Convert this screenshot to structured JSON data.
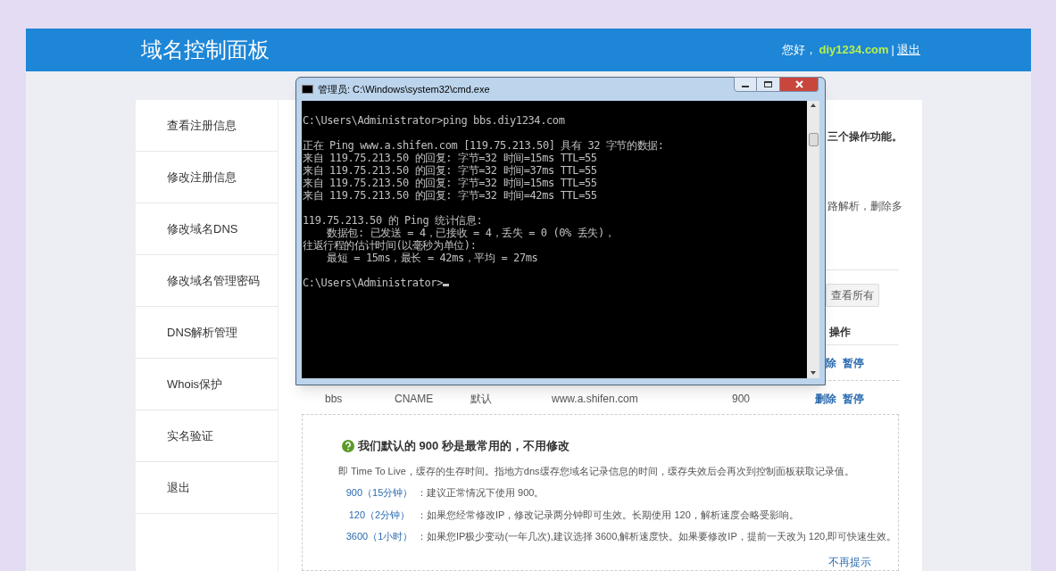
{
  "header": {
    "title": "域名控制面板",
    "greeting": "您好，",
    "account": "diy1234.com",
    "separator": "|",
    "logout": "退出"
  },
  "sidebar": {
    "items": [
      {
        "label": "查看注册信息"
      },
      {
        "label": "修改注册信息"
      },
      {
        "label": "修改域名DNS"
      },
      {
        "label": "修改域名管理密码"
      },
      {
        "label": "DNS解析管理"
      },
      {
        "label": "Whois保护"
      },
      {
        "label": "实名验证"
      },
      {
        "label": "退出"
      }
    ]
  },
  "content": {
    "notes": [
      "三个操作功能。",
      "路解析，删除多"
    ],
    "view_all_button": "查看所有",
    "column_header": "操作",
    "rows": [
      {
        "actions": [
          "除",
          "暂停"
        ]
      },
      {
        "cells": [
          "bbs",
          "CNAME",
          "默认",
          "www.a.shifen.com",
          "900"
        ],
        "actions": [
          "删除",
          "暂停"
        ]
      }
    ]
  },
  "tip": {
    "title": "我们默认的 900 秒是最常用的，不用修改",
    "description": "即 Time To Live，缓存的生存时间。指地方dns缓存您域名记录信息的时间，缓存失效后会再次到控制面板获取记录值。",
    "options": [
      {
        "label": "900（15分钟）",
        "text": "：建议正常情况下使用 900。"
      },
      {
        "label": "120（2分钟）",
        "text": "：如果您经常修改IP，修改记录两分钟即可生效。长期使用 120，解析速度会略受影响。"
      },
      {
        "label": "3600（1小时）",
        "text": "：如果您IP极少变动(一年几次),建议选择 3600,解析速度快。如果要修改IP，提前一天改为 120,即可快速生效。"
      }
    ],
    "dismiss": "不再提示"
  },
  "cmd_window": {
    "title": "管理员: C:\\Windows\\system32\\cmd.exe",
    "blocks": [
      [
        "C:\\Users\\Administrator>ping bbs.diy1234.com"
      ],
      [
        "正在 Ping www.a.shifen.com [119.75.213.50] 具有 32 字节的数据:",
        "来自 119.75.213.50 的回复: 字节=32 时间=15ms TTL=55",
        "来自 119.75.213.50 的回复: 字节=32 时间=37ms TTL=55",
        "来自 119.75.213.50 的回复: 字节=32 时间=15ms TTL=55",
        "来自 119.75.213.50 的回复: 字节=32 时间=42ms TTL=55"
      ],
      [
        "119.75.213.50 的 Ping 统计信息:",
        "    数据包: 已发送 = 4，已接收 = 4，丢失 = 0 (0% 丢失)，",
        "往返行程的估计时间(以毫秒为单位):",
        "    最短 = 15ms，最长 = 42ms，平均 = 27ms"
      ],
      [
        "C:\\Users\\Administrator>"
      ]
    ]
  }
}
